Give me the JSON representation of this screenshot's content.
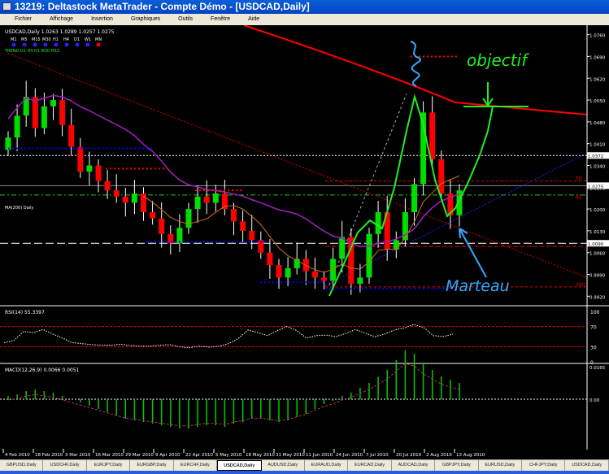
{
  "window": {
    "title": "13219: Deltastock MetaTrader - Compte Démo - [USDCAD,Daily]"
  },
  "menu": [
    "Fichier",
    "Affichage",
    "Insertion",
    "Graphiques",
    "Outils",
    "Fenêtre",
    "Aide"
  ],
  "chart": {
    "info": "USDCAD,Daily 1.0263 1.0289 1.0257 1.0275",
    "timeframes": [
      "M1",
      "M5",
      "M15",
      "M30",
      "H1",
      "H4",
      "D1",
      "W1",
      "MN"
    ],
    "active_timeframe": "MN",
    "trend_text": "TREND D1 H4 H1 M30 M15",
    "ma_label": "MA(200) Daily",
    "fibo_labels": [
      "50",
      "61",
      "100"
    ],
    "annotations": {
      "objective": "objectif",
      "hammer": "Marteau"
    },
    "colors": {
      "bull": "#00dd00",
      "bear": "#ff0000",
      "ma200": "#ff0000",
      "ma_slow": "#a020c0",
      "ma_fast": "#c87020",
      "support": "#0000ff"
    }
  },
  "chart_data": {
    "type": "candlestick",
    "symbol": "USDCAD",
    "timeframe": "Daily",
    "ylim": [
      0.99,
      1.078
    ],
    "closes": [
      1.043,
      1.05,
      1.056,
      1.046,
      1.053,
      1.055,
      1.047,
      1.04,
      1.032,
      1.034,
      1.029,
      1.026,
      1.024,
      1.022,
      1.025,
      1.019,
      1.017,
      1.012,
      1.009,
      1.014,
      1.02,
      1.024,
      1.022,
      1.025,
      1.02,
      1.016,
      1.013,
      1.01,
      1.006,
      1.002,
      0.998,
      1.001,
      1.004,
      1.0,
      0.998,
      0.997,
      1.004,
      1.011,
      0.996,
      0.998,
      1.012,
      1.019,
      1.007,
      1.01,
      1.019,
      1.028,
      1.051,
      1.036,
      1.025,
      1.018,
      1.026
    ],
    "price_ticks": [
      "1.0760",
      "1.0690",
      "1.0620",
      "1.0550",
      "1.0480",
      "1.0410",
      "1.0340",
      "1.0270",
      "1.0200",
      "1.0130",
      "1.0060",
      "0.9990",
      "0.9920"
    ],
    "highlighted_prices": [
      "1.0372",
      "1.0275",
      "1.0090"
    ],
    "rsi": {
      "title": "RSI(14) 55.3397",
      "levels": [
        "100",
        "70",
        "30",
        "0"
      ],
      "values": [
        38,
        42,
        60,
        58,
        64,
        55,
        47,
        38,
        36,
        34,
        33,
        33,
        35,
        32,
        31,
        31,
        33,
        34,
        30,
        28,
        31,
        29,
        31,
        36,
        46,
        63,
        58,
        52,
        62,
        70,
        62,
        47,
        52,
        53,
        50,
        56,
        64,
        57,
        50,
        55,
        63,
        67,
        74,
        68,
        52,
        50,
        55
      ]
    },
    "macd": {
      "title": "MACD(12,26,9) 0.0066 0.0051",
      "levels": [
        "0.0165",
        "0.00"
      ],
      "hist": [
        2,
        3,
        5,
        6,
        5,
        4,
        2,
        0,
        -2,
        -4,
        -6,
        -8,
        -10,
        -12,
        -13,
        -14,
        -15,
        -16,
        -17,
        -18,
        -18,
        -17,
        -16,
        -16,
        -17,
        -15,
        -14,
        -12,
        -12,
        -13,
        -14,
        -13,
        -11,
        -9,
        -6,
        -3,
        -1,
        2,
        4,
        7,
        10,
        14,
        18,
        24,
        30,
        28,
        22,
        18,
        14,
        12,
        10
      ]
    },
    "time_labels": [
      "4 Feb 2010",
      "18 Feb 2010",
      "3 Mar 2010",
      "16 Mar 2010",
      "29 Mar 2010",
      "9 Apr 2010",
      "22 Apr 2010",
      "5 May 2010",
      "18 May 2010",
      "31 May 2010",
      "11 Jun 2010",
      "24 Jun 2010",
      "7 Jul 2010",
      "20 Jul 2010",
      "2 Aug 2010",
      "13 Aug 2010"
    ]
  },
  "tabs": [
    "GBPUSD,Daily",
    "USDCHF,Daily",
    "EURJPY,Daily",
    "EURGBP,Daily",
    "EURCHF,Daily",
    "USDCAD,Daily",
    "AUDUSD,Daily",
    "EURAUD,Daily",
    "EURCAD,Daily",
    "AUDCAD,Daily",
    "GBPJPY,Daily",
    "EURUSD,Daily",
    "CHFJPY,Daily",
    "USDCAD,Daily"
  ],
  "active_tab": 5
}
